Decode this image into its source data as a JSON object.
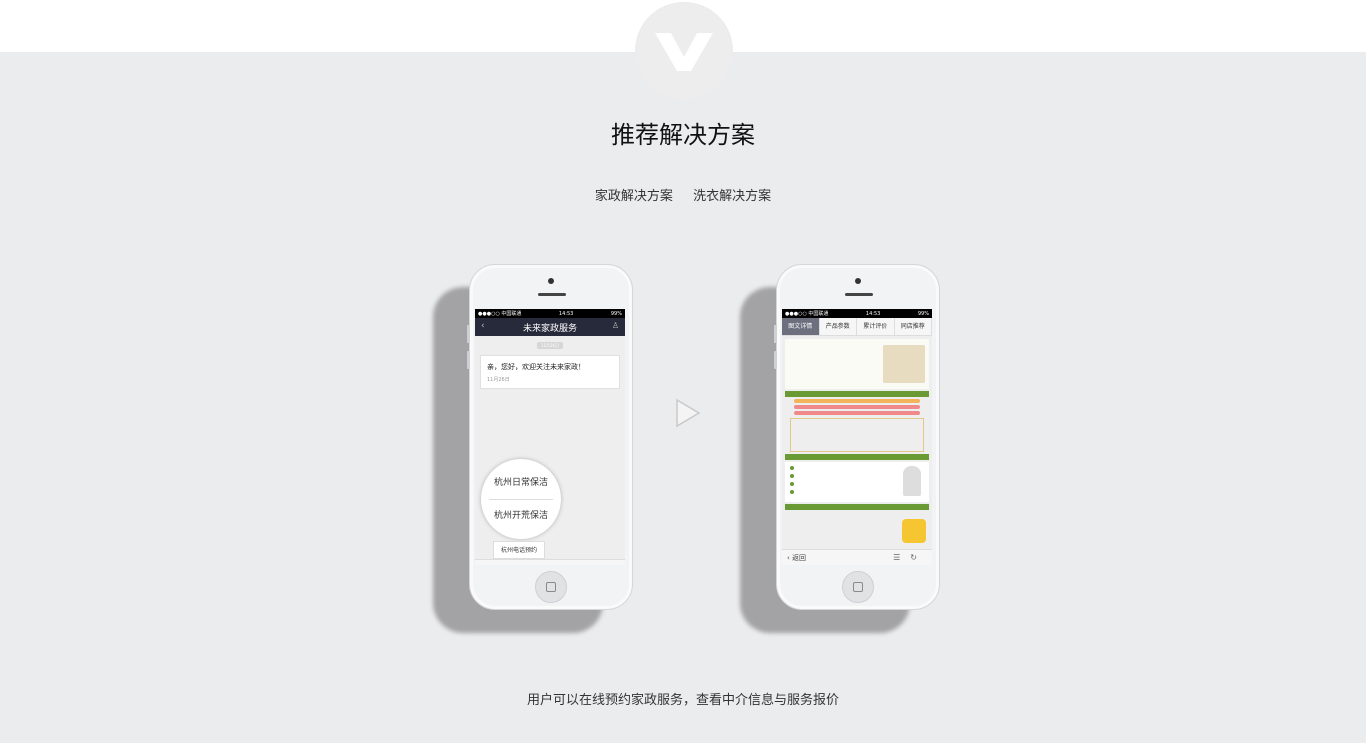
{
  "header": {
    "logo_icon": "v-logo-icon",
    "title": "推荐解决方案",
    "tabs": [
      {
        "label": "家政解决方案"
      },
      {
        "label": "洗衣解决方案"
      }
    ]
  },
  "phone_left": {
    "status": {
      "carrier": "●●●○○ 中国联通",
      "time": "14:53",
      "battery": "99%"
    },
    "nav_title": "未来家政服务",
    "date_chip": "11月26日",
    "message": {
      "text": "亲，您好，欢迎关注未来家政！",
      "date": "11月26日"
    },
    "menu_items": [
      "杭州日常保洁",
      "杭州开荒保洁"
    ],
    "popup_item": "杭州电话预约"
  },
  "phone_right": {
    "status": {
      "carrier": "●●●○○ 中国联通",
      "time": "14:53",
      "battery": "99%"
    },
    "tabs": [
      "图文详情",
      "产品参数",
      "累计评价",
      "同店推荐"
    ],
    "back_label": "返回"
  },
  "caption": "用户可以在线预约家政服务，查看中介信息与服务报价",
  "colors": {
    "background": "#ebecee",
    "nav_dark": "#262a3b",
    "accent_green": "#6a9a33"
  }
}
